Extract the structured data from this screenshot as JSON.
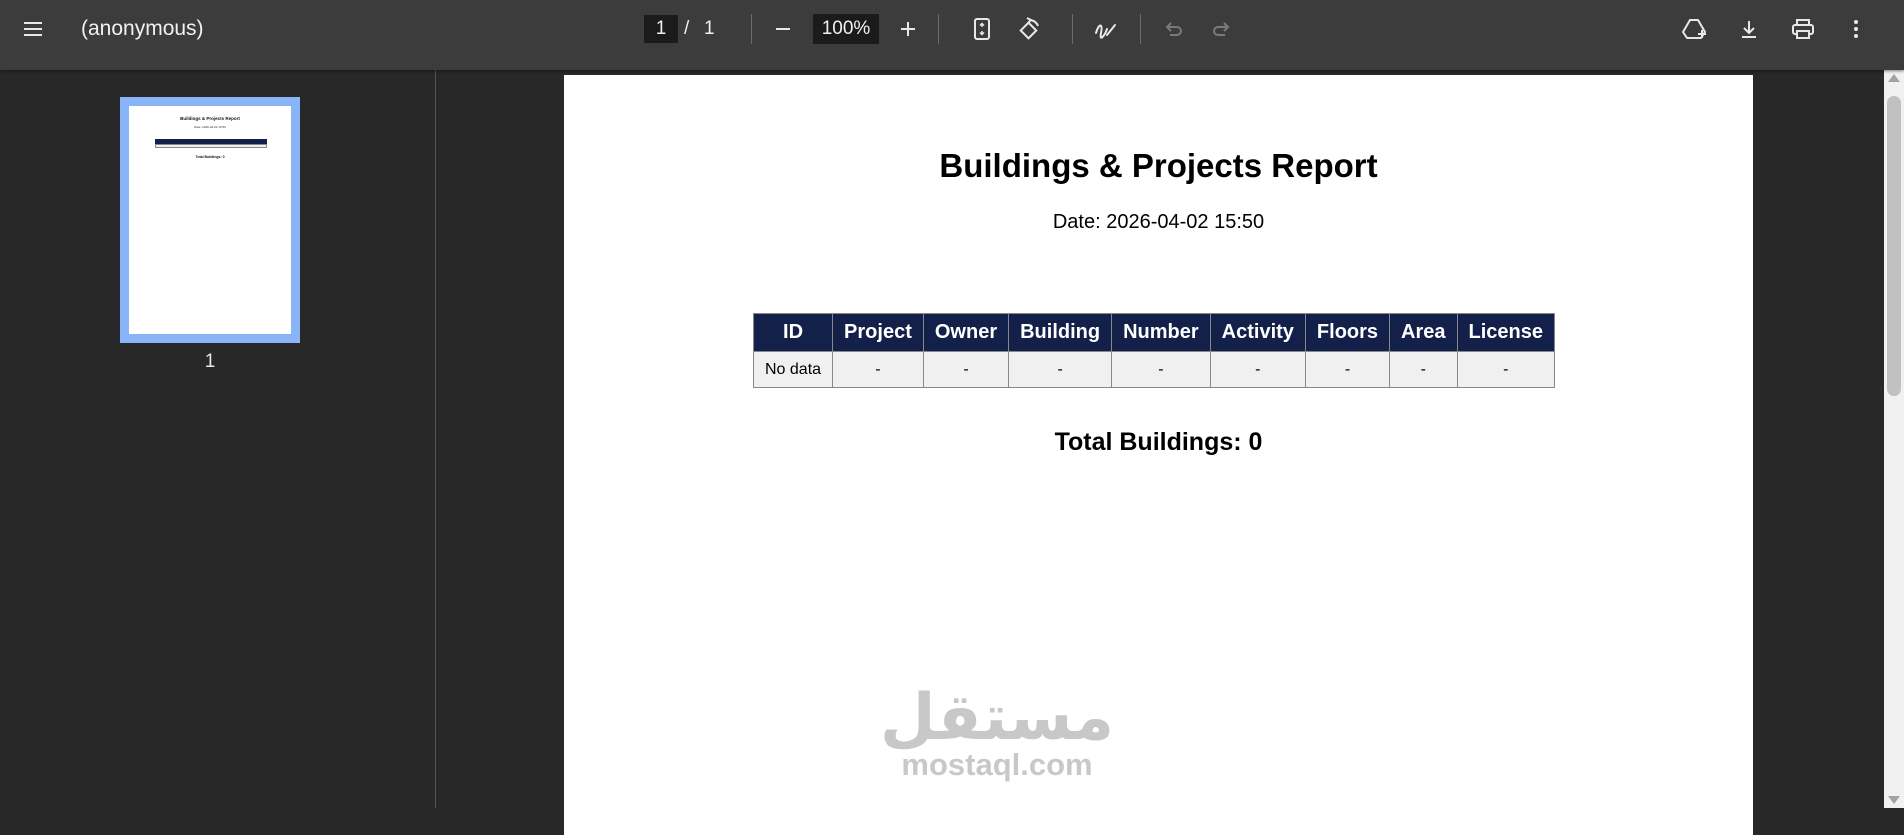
{
  "toolbar": {
    "menu_icon": "hamburger-menu-icon",
    "title": "(anonymous)",
    "page_current": "1",
    "page_separator": "/",
    "page_total": "1",
    "zoom_out_icon": "minus-icon",
    "zoom_value": "100%",
    "zoom_in_icon": "plus-icon",
    "fit_page_icon": "fit-to-page-icon",
    "rotate_icon": "rotate-icon",
    "draw_icon": "annotate-pen-icon",
    "undo_icon": "undo-icon",
    "redo_icon": "redo-icon",
    "drive_icon": "save-to-drive-icon",
    "download_icon": "download-icon",
    "print_icon": "print-icon",
    "more_icon": "more-vertical-icon"
  },
  "sidebar": {
    "thumbnails": [
      {
        "page_number": "1",
        "selected": true
      }
    ]
  },
  "document": {
    "title": "Buildings & Projects Report",
    "date": "Date: 2026-04-02 15:50",
    "table": {
      "headers": [
        "ID",
        "Project",
        "Owner",
        "Building",
        "Number",
        "Activity",
        "Floors",
        "Area",
        "License"
      ],
      "rows": [
        [
          "No data",
          "-",
          "-",
          "-",
          "-",
          "-",
          "-",
          "-",
          "-"
        ]
      ]
    },
    "total": "Total Buildings: 0",
    "watermark": {
      "arabic": "مستقل",
      "latin": "mostaql.com"
    }
  },
  "colors": {
    "toolbar_bg": "#3c3c3c",
    "viewer_bg": "#282828",
    "table_header_bg": "#13204a",
    "table_cell_bg": "#f0f0f0",
    "thumbnail_highlight": "#8ab4f8"
  }
}
